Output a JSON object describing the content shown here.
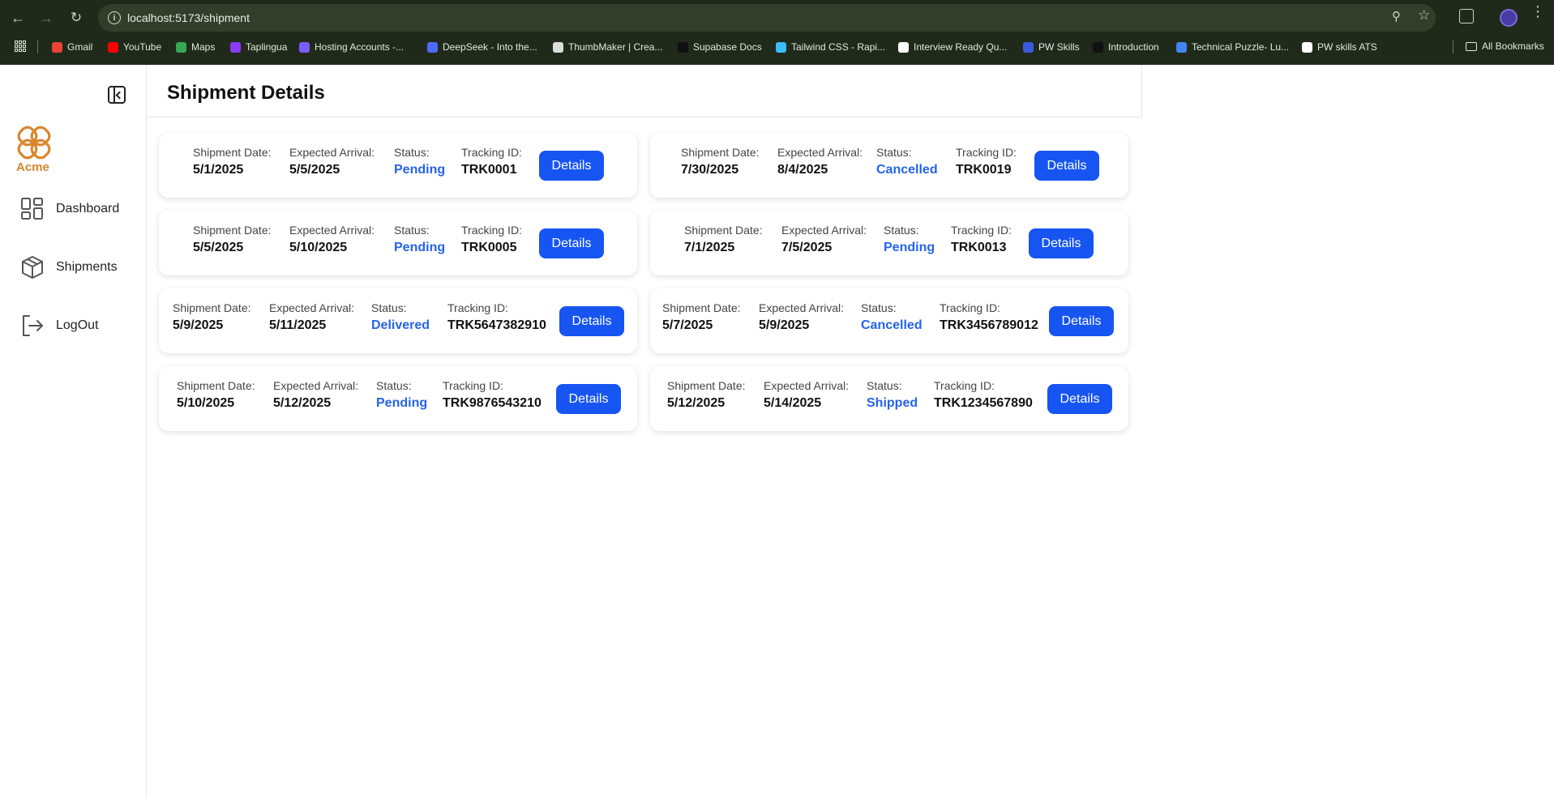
{
  "browser": {
    "url": "localhost:5173/shipment",
    "bookmarks": [
      {
        "label": "Gmail",
        "color": "#ea4335"
      },
      {
        "label": "YouTube",
        "color": "#ff0000"
      },
      {
        "label": "Maps",
        "color": "#34a853"
      },
      {
        "label": "Taplingua",
        "color": "#8b3cf7"
      },
      {
        "label": "Hosting Accounts -...",
        "color": "#7a5cff"
      },
      {
        "label": "DeepSeek - Into the...",
        "color": "#4d6bfe"
      },
      {
        "label": "ThumbMaker | Crea...",
        "color": "#dddddd"
      },
      {
        "label": "Supabase Docs",
        "color": "#111111"
      },
      {
        "label": "Tailwind CSS - Rapi...",
        "color": "#38bdf8"
      },
      {
        "label": "Interview Ready Qu...",
        "color": "#ffffff"
      },
      {
        "label": "PW Skills",
        "color": "#3b5bdb"
      },
      {
        "label": "Introduction",
        "color": "#111111"
      },
      {
        "label": "Technical Puzzle- Lu...",
        "color": "#4285f4"
      },
      {
        "label": "PW skills ATS",
        "color": "#ffffff"
      }
    ],
    "all_bookmarks": "All Bookmarks"
  },
  "sidebar": {
    "brand": "Acme",
    "brand_color": "#d9862b",
    "items": [
      {
        "label": "Dashboard",
        "icon": "dashboard-icon"
      },
      {
        "label": "Shipments",
        "icon": "box-icon"
      },
      {
        "label": "LogOut",
        "icon": "logout-icon"
      }
    ]
  },
  "page": {
    "title": "Shipment Details",
    "labels": {
      "shipment_date": "Shipment Date:",
      "expected_arrival": "Expected Arrival:",
      "status": "Status:",
      "tracking_id": "Tracking ID:",
      "details_button": "Details"
    }
  },
  "shipments": [
    {
      "shipment_date": "5/1/2025",
      "expected_arrival": "5/5/2025",
      "status": "Pending",
      "tracking_id": "TRK0001"
    },
    {
      "shipment_date": "7/30/2025",
      "expected_arrival": "8/4/2025",
      "status": "Cancelled",
      "tracking_id": "TRK0019"
    },
    {
      "shipment_date": "5/5/2025",
      "expected_arrival": "5/10/2025",
      "status": "Pending",
      "tracking_id": "TRK0005"
    },
    {
      "shipment_date": "7/1/2025",
      "expected_arrival": "7/5/2025",
      "status": "Pending",
      "tracking_id": "TRK0013"
    },
    {
      "shipment_date": "5/9/2025",
      "expected_arrival": "5/11/2025",
      "status": "Delivered",
      "tracking_id": "TRK5647382910"
    },
    {
      "shipment_date": "5/7/2025",
      "expected_arrival": "5/9/2025",
      "status": "Cancelled",
      "tracking_id": "TRK3456789012"
    },
    {
      "shipment_date": "5/10/2025",
      "expected_arrival": "5/12/2025",
      "status": "Pending",
      "tracking_id": "TRK9876543210"
    },
    {
      "shipment_date": "5/12/2025",
      "expected_arrival": "5/14/2025",
      "status": "Shipped",
      "tracking_id": "TRK1234567890"
    }
  ],
  "colors": {
    "accent": "#1755f2",
    "status_text": "#2563eb"
  }
}
